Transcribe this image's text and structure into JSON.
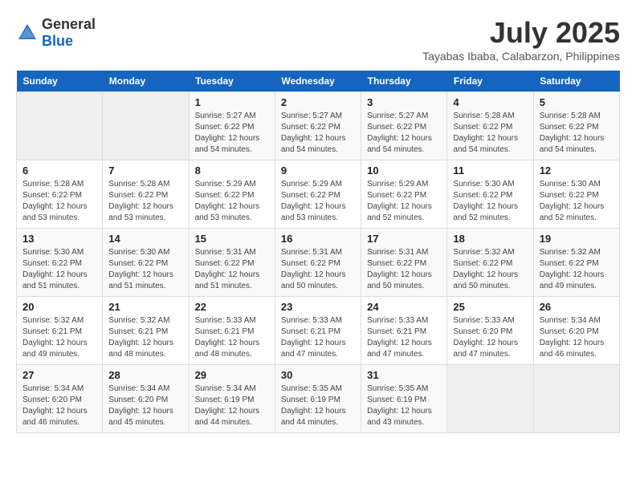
{
  "header": {
    "logo_general": "General",
    "logo_blue": "Blue",
    "title": "July 2025",
    "subtitle": "Tayabas Ibaba, Calabarzon, Philippines"
  },
  "calendar": {
    "days_of_week": [
      "Sunday",
      "Monday",
      "Tuesday",
      "Wednesday",
      "Thursday",
      "Friday",
      "Saturday"
    ],
    "weeks": [
      [
        {
          "day": "",
          "info": ""
        },
        {
          "day": "",
          "info": ""
        },
        {
          "day": "1",
          "info": "Sunrise: 5:27 AM\nSunset: 6:22 PM\nDaylight: 12 hours and 54 minutes."
        },
        {
          "day": "2",
          "info": "Sunrise: 5:27 AM\nSunset: 6:22 PM\nDaylight: 12 hours and 54 minutes."
        },
        {
          "day": "3",
          "info": "Sunrise: 5:27 AM\nSunset: 6:22 PM\nDaylight: 12 hours and 54 minutes."
        },
        {
          "day": "4",
          "info": "Sunrise: 5:28 AM\nSunset: 6:22 PM\nDaylight: 12 hours and 54 minutes."
        },
        {
          "day": "5",
          "info": "Sunrise: 5:28 AM\nSunset: 6:22 PM\nDaylight: 12 hours and 54 minutes."
        }
      ],
      [
        {
          "day": "6",
          "info": "Sunrise: 5:28 AM\nSunset: 6:22 PM\nDaylight: 12 hours and 53 minutes."
        },
        {
          "day": "7",
          "info": "Sunrise: 5:28 AM\nSunset: 6:22 PM\nDaylight: 12 hours and 53 minutes."
        },
        {
          "day": "8",
          "info": "Sunrise: 5:29 AM\nSunset: 6:22 PM\nDaylight: 12 hours and 53 minutes."
        },
        {
          "day": "9",
          "info": "Sunrise: 5:29 AM\nSunset: 6:22 PM\nDaylight: 12 hours and 53 minutes."
        },
        {
          "day": "10",
          "info": "Sunrise: 5:29 AM\nSunset: 6:22 PM\nDaylight: 12 hours and 52 minutes."
        },
        {
          "day": "11",
          "info": "Sunrise: 5:30 AM\nSunset: 6:22 PM\nDaylight: 12 hours and 52 minutes."
        },
        {
          "day": "12",
          "info": "Sunrise: 5:30 AM\nSunset: 6:22 PM\nDaylight: 12 hours and 52 minutes."
        }
      ],
      [
        {
          "day": "13",
          "info": "Sunrise: 5:30 AM\nSunset: 6:22 PM\nDaylight: 12 hours and 51 minutes."
        },
        {
          "day": "14",
          "info": "Sunrise: 5:30 AM\nSunset: 6:22 PM\nDaylight: 12 hours and 51 minutes."
        },
        {
          "day": "15",
          "info": "Sunrise: 5:31 AM\nSunset: 6:22 PM\nDaylight: 12 hours and 51 minutes."
        },
        {
          "day": "16",
          "info": "Sunrise: 5:31 AM\nSunset: 6:22 PM\nDaylight: 12 hours and 50 minutes."
        },
        {
          "day": "17",
          "info": "Sunrise: 5:31 AM\nSunset: 6:22 PM\nDaylight: 12 hours and 50 minutes."
        },
        {
          "day": "18",
          "info": "Sunrise: 5:32 AM\nSunset: 6:22 PM\nDaylight: 12 hours and 50 minutes."
        },
        {
          "day": "19",
          "info": "Sunrise: 5:32 AM\nSunset: 6:22 PM\nDaylight: 12 hours and 49 minutes."
        }
      ],
      [
        {
          "day": "20",
          "info": "Sunrise: 5:32 AM\nSunset: 6:21 PM\nDaylight: 12 hours and 49 minutes."
        },
        {
          "day": "21",
          "info": "Sunrise: 5:32 AM\nSunset: 6:21 PM\nDaylight: 12 hours and 48 minutes."
        },
        {
          "day": "22",
          "info": "Sunrise: 5:33 AM\nSunset: 6:21 PM\nDaylight: 12 hours and 48 minutes."
        },
        {
          "day": "23",
          "info": "Sunrise: 5:33 AM\nSunset: 6:21 PM\nDaylight: 12 hours and 47 minutes."
        },
        {
          "day": "24",
          "info": "Sunrise: 5:33 AM\nSunset: 6:21 PM\nDaylight: 12 hours and 47 minutes."
        },
        {
          "day": "25",
          "info": "Sunrise: 5:33 AM\nSunset: 6:20 PM\nDaylight: 12 hours and 47 minutes."
        },
        {
          "day": "26",
          "info": "Sunrise: 5:34 AM\nSunset: 6:20 PM\nDaylight: 12 hours and 46 minutes."
        }
      ],
      [
        {
          "day": "27",
          "info": "Sunrise: 5:34 AM\nSunset: 6:20 PM\nDaylight: 12 hours and 46 minutes."
        },
        {
          "day": "28",
          "info": "Sunrise: 5:34 AM\nSunset: 6:20 PM\nDaylight: 12 hours and 45 minutes."
        },
        {
          "day": "29",
          "info": "Sunrise: 5:34 AM\nSunset: 6:19 PM\nDaylight: 12 hours and 44 minutes."
        },
        {
          "day": "30",
          "info": "Sunrise: 5:35 AM\nSunset: 6:19 PM\nDaylight: 12 hours and 44 minutes."
        },
        {
          "day": "31",
          "info": "Sunrise: 5:35 AM\nSunset: 6:19 PM\nDaylight: 12 hours and 43 minutes."
        },
        {
          "day": "",
          "info": ""
        },
        {
          "day": "",
          "info": ""
        }
      ]
    ]
  }
}
